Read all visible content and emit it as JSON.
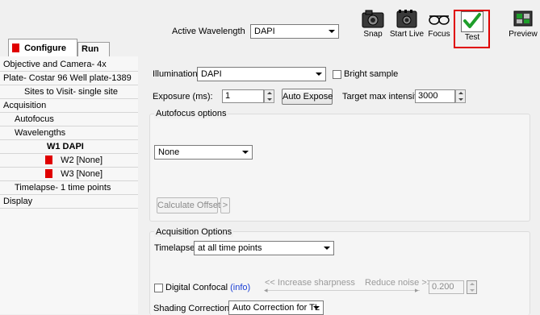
{
  "header": {
    "active_wavelength_label": "Active Wavelength",
    "active_wavelength_value": "DAPI",
    "tools": [
      {
        "label": "Snap"
      },
      {
        "label": "Start Live"
      },
      {
        "label": "Focus"
      },
      {
        "label": "Test"
      },
      {
        "label": "Preview"
      }
    ]
  },
  "tabs": {
    "configure": "Configure",
    "run": "Run"
  },
  "tree": {
    "items": [
      "Objective and Camera- 4x",
      "Plate- Costar 96 Well plate-1389",
      "Sites to Visit- single site",
      "Acquisition",
      "Autofocus",
      "Wavelengths",
      "W1 DAPI",
      "W2 [None]",
      "W3 [None]",
      "Timelapse- 1 time points",
      "Display"
    ]
  },
  "form": {
    "illumination_label": "Illumination:",
    "illumination_value": "DAPI",
    "bright_sample_label": "Bright sample",
    "exposure_label": "Exposure (ms):",
    "exposure_value": "1",
    "auto_expose_label": "Auto Expose",
    "target_max_label": "Target max intensity:",
    "target_max_value": "3000",
    "autofocus_options_label": "Autofocus options",
    "autofocus_value": "None",
    "calculate_offset_label": "Calculate Offset",
    "calculate_offset_more": ">",
    "acquisition_options_label": "Acquisition Options",
    "timelapse_label": "Timelapse:",
    "timelapse_value": "at all time points",
    "digital_confocal_label": "Digital Confocal",
    "info_link": "(info)",
    "increase_sharpness": "<< Increase sharpness",
    "reduce_noise": "Reduce noise >>",
    "noise_value": "0.200",
    "shading_label": "Shading Correction:",
    "shading_value": "Auto Correction for TL"
  },
  "colors": {
    "accent_red": "#e00000",
    "highlight_border": "#e00000",
    "check_green": "#1e9e2a",
    "link_blue": "#1a3fd6"
  }
}
